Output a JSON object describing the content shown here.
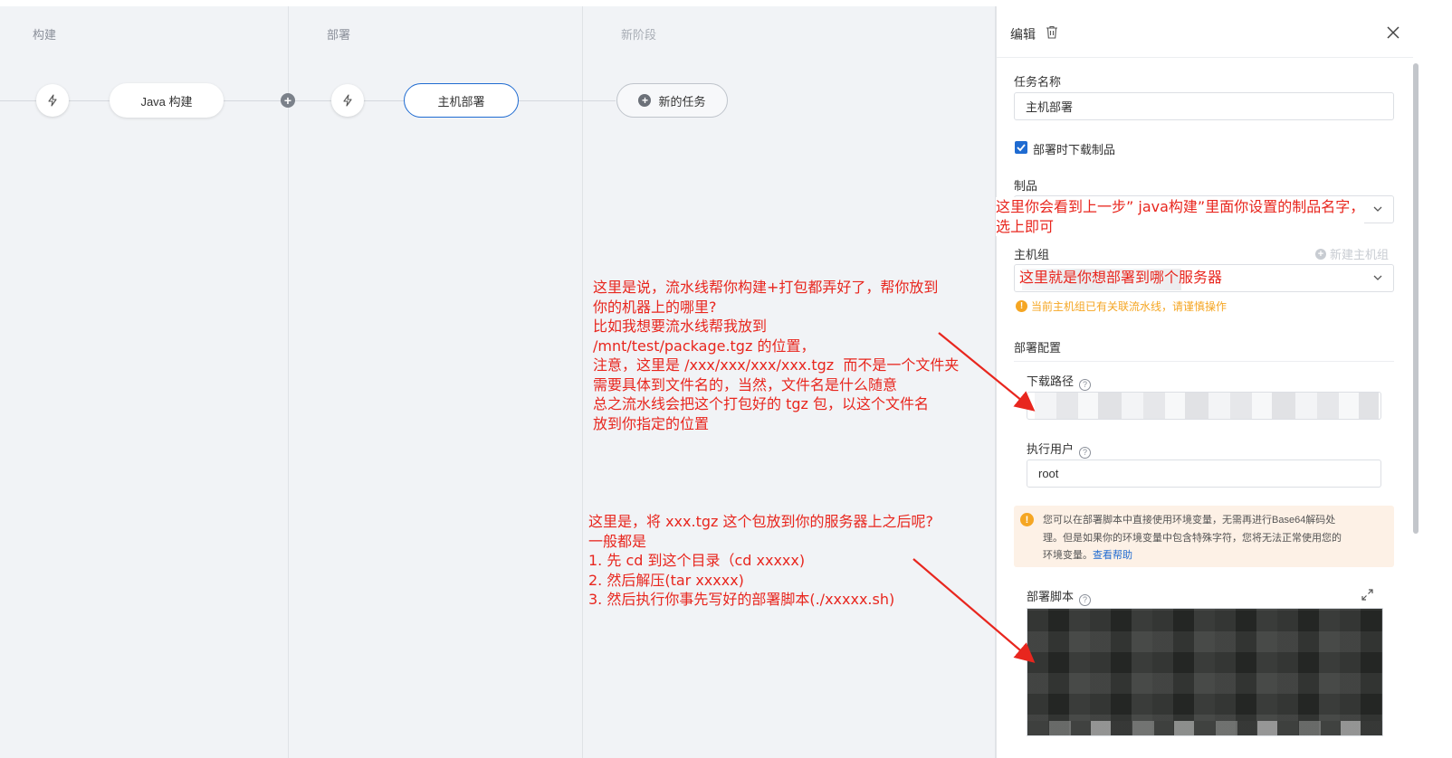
{
  "stages": [
    {
      "title": "构建"
    },
    {
      "title": "部署"
    },
    {
      "title": "新阶段"
    }
  ],
  "tasks": {
    "build": "Java 构建",
    "deploy": "主机部署",
    "new_task": "新的任务"
  },
  "panel": {
    "header_title": "编辑",
    "task_name_label": "任务名称",
    "task_name_value": "主机部署",
    "download_checkbox_label": "部署时下载制品",
    "download_checked": true,
    "artifact_label": "制品",
    "host_group_label": "主机组",
    "new_host_group_link": "新建主机组",
    "host_group_warning": "当前主机组已有关联流水线，请谨慎操作",
    "deploy_config_label": "部署配置",
    "download_path_label": "下载路径",
    "exec_user_label": "执行用户",
    "exec_user_value": "root",
    "env_notice": "您可以在部署脚本中直接使用环境变量，无需再进行Base64解码处理。但是如果你的环境变量中包含特殊字符，您将无法正常使用您的环境变量。",
    "env_notice_line1": "您可以在部署脚本中直接使用环境变量，无需再进行Base64解码处",
    "env_notice_line2": "理。但是如果你的环境变量中包含特殊字符，您将无法正常使用您的",
    "env_notice_line3": "环境变量。",
    "help_link": "查看帮助",
    "deploy_script_label": "部署脚本"
  },
  "annotations": {
    "artifact_note": "这里你会看到上一步” java构建”里面你设置的制品名字，\n选上即可",
    "host_group_note": "这里就是你想部署到哪个服务器",
    "path_note": "这里是说，流水线帮你构建+打包都弄好了，帮你放到\n你的机器上的哪里?\n比如我想要流水线帮我放到\n/mnt/test/package.tgz 的位置，\n注意，这里是 /xxx/xxx/xxx/xxx.tgz  而不是一个文件夹\n需要具体到文件名的，当然，文件名是什么随意\n总之流水线会把这个打包好的 tgz 包，以这个文件名\n放到你指定的位置",
    "script_note": "这里是，将 xxx.tgz 这个包放到你的服务器上之后呢?\n一般都是\n1. 先 cd 到这个目录（cd xxxxx)\n2. 然后解压(tar xxxxx)\n3. 然后执行你事先写好的部署脚本(./xxxxx.sh)"
  },
  "colors": {
    "annotation": "#e8261e",
    "accent": "#1f6bd1",
    "warning": "#f5a623"
  }
}
